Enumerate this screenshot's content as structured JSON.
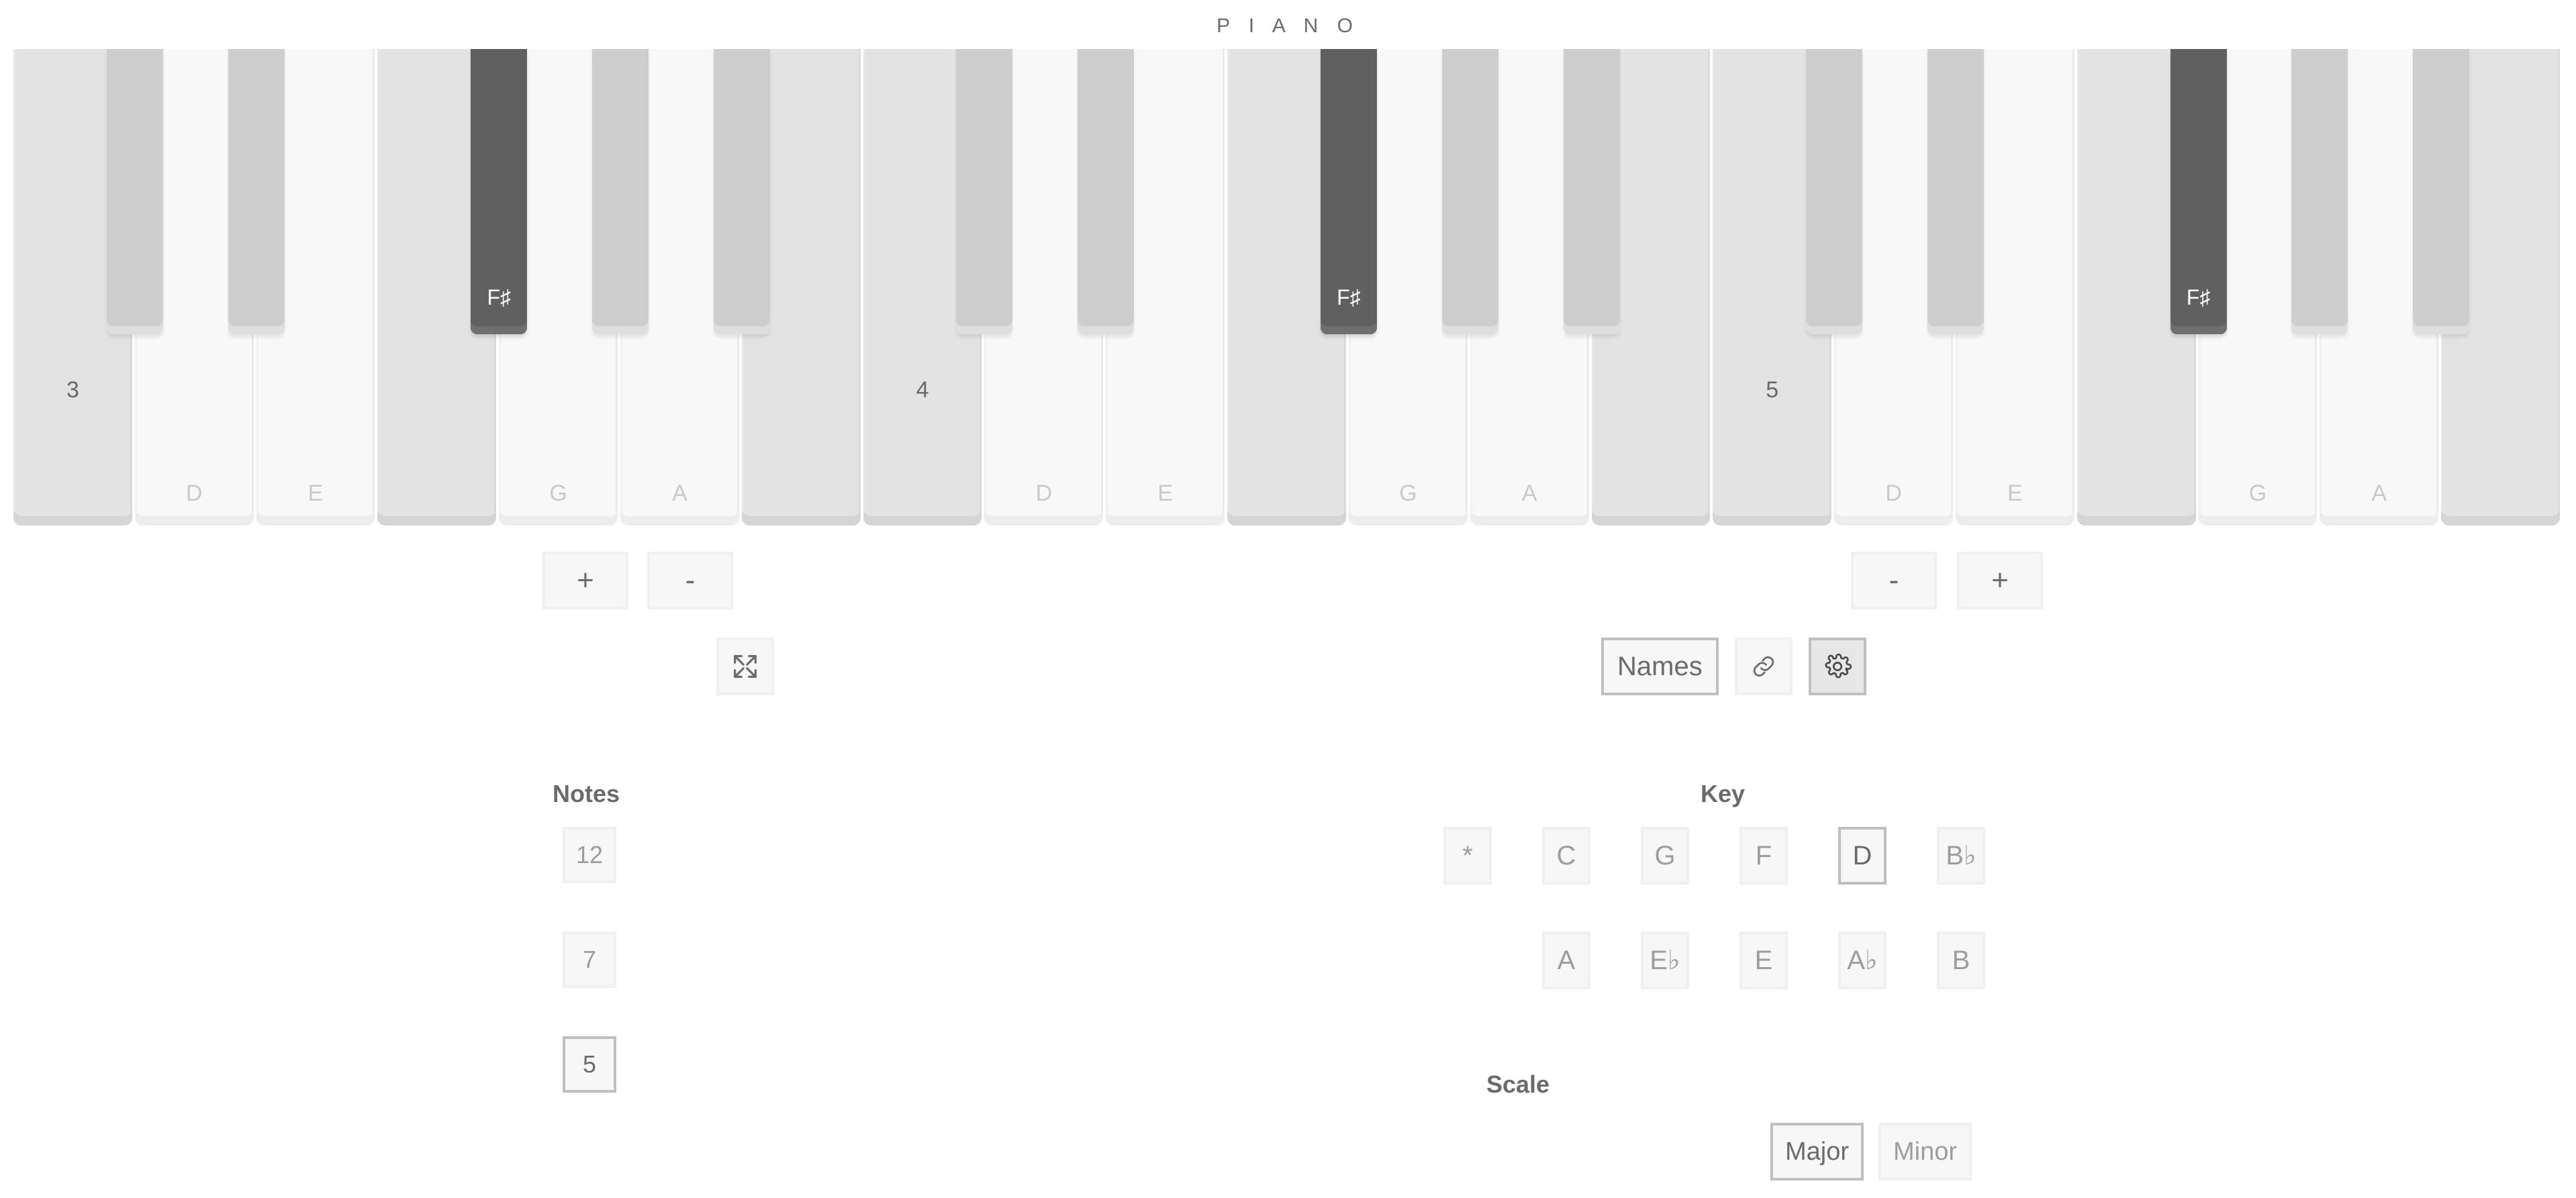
{
  "app": {
    "title": "P I A N O"
  },
  "keyboard": {
    "white_keys": [
      {
        "note": "C",
        "label": "",
        "octave": "3",
        "in_scale": false
      },
      {
        "note": "D",
        "label": "D",
        "octave": "",
        "in_scale": true
      },
      {
        "note": "E",
        "label": "E",
        "octave": "",
        "in_scale": true
      },
      {
        "note": "F",
        "label": "",
        "octave": "",
        "in_scale": false
      },
      {
        "note": "G",
        "label": "G",
        "octave": "",
        "in_scale": true
      },
      {
        "note": "A",
        "label": "A",
        "octave": "",
        "in_scale": true
      },
      {
        "note": "B",
        "label": "",
        "octave": "",
        "in_scale": false
      },
      {
        "note": "C",
        "label": "",
        "octave": "4",
        "in_scale": false
      },
      {
        "note": "D",
        "label": "D",
        "octave": "",
        "in_scale": true
      },
      {
        "note": "E",
        "label": "E",
        "octave": "",
        "in_scale": true
      },
      {
        "note": "F",
        "label": "",
        "octave": "",
        "in_scale": false
      },
      {
        "note": "G",
        "label": "G",
        "octave": "",
        "in_scale": true
      },
      {
        "note": "A",
        "label": "A",
        "octave": "",
        "in_scale": true
      },
      {
        "note": "B",
        "label": "",
        "octave": "",
        "in_scale": false
      },
      {
        "note": "C",
        "label": "",
        "octave": "5",
        "in_scale": false
      },
      {
        "note": "D",
        "label": "D",
        "octave": "",
        "in_scale": true
      },
      {
        "note": "E",
        "label": "E",
        "octave": "",
        "in_scale": true
      },
      {
        "note": "F",
        "label": "",
        "octave": "",
        "in_scale": false
      },
      {
        "note": "G",
        "label": "G",
        "octave": "",
        "in_scale": true
      },
      {
        "note": "A",
        "label": "A",
        "octave": "",
        "in_scale": true
      },
      {
        "note": "B",
        "label": "",
        "octave": "",
        "in_scale": false
      }
    ],
    "black_keys": [
      {
        "note": "C#",
        "label": "",
        "after_white": 0,
        "in_scale": false
      },
      {
        "note": "D#",
        "label": "",
        "after_white": 1,
        "in_scale": false
      },
      {
        "note": "F#",
        "label": "F♯",
        "after_white": 3,
        "in_scale": true
      },
      {
        "note": "G#",
        "label": "",
        "after_white": 4,
        "in_scale": false
      },
      {
        "note": "A#",
        "label": "",
        "after_white": 5,
        "in_scale": false
      },
      {
        "note": "C#",
        "label": "",
        "after_white": 7,
        "in_scale": false
      },
      {
        "note": "D#",
        "label": "",
        "after_white": 8,
        "in_scale": false
      },
      {
        "note": "F#",
        "label": "F♯",
        "after_white": 10,
        "in_scale": true
      },
      {
        "note": "G#",
        "label": "",
        "after_white": 11,
        "in_scale": false
      },
      {
        "note": "A#",
        "label": "",
        "after_white": 12,
        "in_scale": false
      },
      {
        "note": "C#",
        "label": "",
        "after_white": 14,
        "in_scale": false
      },
      {
        "note": "D#",
        "label": "",
        "after_white": 15,
        "in_scale": false
      },
      {
        "note": "F#",
        "label": "F♯",
        "after_white": 17,
        "in_scale": true
      },
      {
        "note": "G#",
        "label": "",
        "after_white": 18,
        "in_scale": false
      },
      {
        "note": "A#",
        "label": "",
        "after_white": 19,
        "in_scale": false
      }
    ]
  },
  "left_controls": {
    "plus_label": "+",
    "minus_label": "-",
    "fullscreen_icon": "fullscreen-expand-icon"
  },
  "right_controls": {
    "minus_label": "-",
    "plus_label": "+",
    "names_label": "Names",
    "link_icon": "chain-link-icon",
    "gear_icon": "gear-icon",
    "gear_active": true,
    "names_selected": true
  },
  "notes_panel": {
    "title": "Notes",
    "options": [
      {
        "label": "12",
        "selected": false
      },
      {
        "label": "7",
        "selected": false
      },
      {
        "label": "5",
        "selected": true
      }
    ]
  },
  "key_panel": {
    "title": "Key",
    "row1": [
      {
        "label": "*",
        "selected": false
      },
      {
        "label": "C",
        "selected": false
      },
      {
        "label": "G",
        "selected": false
      },
      {
        "label": "F",
        "selected": false
      },
      {
        "label": "D",
        "selected": true
      },
      {
        "label": "B♭",
        "selected": false
      }
    ],
    "row2": [
      {
        "label": "A",
        "selected": false
      },
      {
        "label": "E♭",
        "selected": false
      },
      {
        "label": "E",
        "selected": false
      },
      {
        "label": "A♭",
        "selected": false
      },
      {
        "label": "B",
        "selected": false
      }
    ]
  },
  "scale_panel": {
    "title": "Scale",
    "options": [
      {
        "label": "Major",
        "selected": true
      },
      {
        "label": "Minor",
        "selected": false
      }
    ]
  },
  "colors": {
    "white_key_on": "#f8f8f8",
    "white_key_off": "#e3e3e3",
    "black_key_on": "#606060",
    "black_key_off": "#cdcdcd",
    "text": "#6b6b6b",
    "muted_text": "#9d9d9d",
    "border_selected": "#bfbfbf"
  }
}
